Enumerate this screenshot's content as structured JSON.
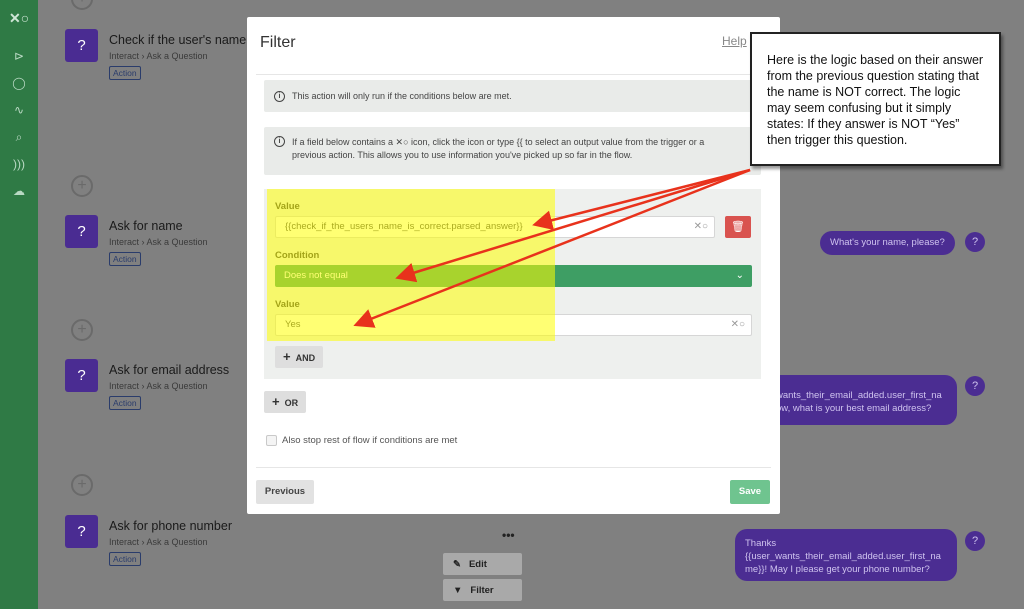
{
  "rail": {
    "logo": "✕○"
  },
  "steps": [
    {
      "title": "Check if the user's name i",
      "crumb": "Interact › Ask a Question",
      "badge": "Action"
    },
    {
      "title": "Ask for name",
      "crumb": "Interact › Ask a Question",
      "badge": "Action"
    },
    {
      "title": "Ask for email address",
      "crumb": "Interact › Ask a Question",
      "badge": "Action"
    },
    {
      "title": "Ask for phone number",
      "crumb": "Interact › Ask a Question",
      "badge": "Action"
    }
  ],
  "bubbles": {
    "name": "What's your name, please?",
    "email_line1": "wants_their_email_added.user_first_na",
    "email_line2": "ow, what is your best email address?",
    "phone_line1": "Thanks",
    "phone_line2": "{{user_wants_their_email_added.user_first_na",
    "phone_line3": "me}}! May I please get your phone number?"
  },
  "bg_buttons": {
    "edit": "Edit",
    "filter": "Filter",
    "more": "•••"
  },
  "modal": {
    "title": "Filter",
    "help": "Help",
    "info1": "This action will only run if the conditions below are met.",
    "info2_line1": "If a field below contains a ✕○ icon, click the icon or type {{ to select an output value from the trigger or a",
    "info2_line2": "previous action. This allows you to use information you've picked up so far in the flow.",
    "value_label_1": "Value",
    "value_1": "{{check_if_the_users_name_is_correct.parsed_answer}}",
    "condition_label": "Condition",
    "condition": "Does not equal",
    "value_label_2": "Value",
    "value_2": "Yes",
    "and_label": "AND",
    "or_label": "OR",
    "stop_label": "Also stop rest of flow if conditions are met",
    "previous": "Previous",
    "save": "Save"
  },
  "callout": "Here is the logic based on their answer from the previous question stating that the name is NOT correct. The logic may seem confusing but it simply states: If they answer is NOT “Yes” then trigger this question.",
  "colors": {
    "rail": "#2f7a45",
    "action_icon": "#4a2c92",
    "condition_green": "#3e9e64",
    "save_green": "#6fc48f",
    "delete_red": "#d9534f",
    "highlight": "#ffff00",
    "arrow": "#e8321c"
  }
}
